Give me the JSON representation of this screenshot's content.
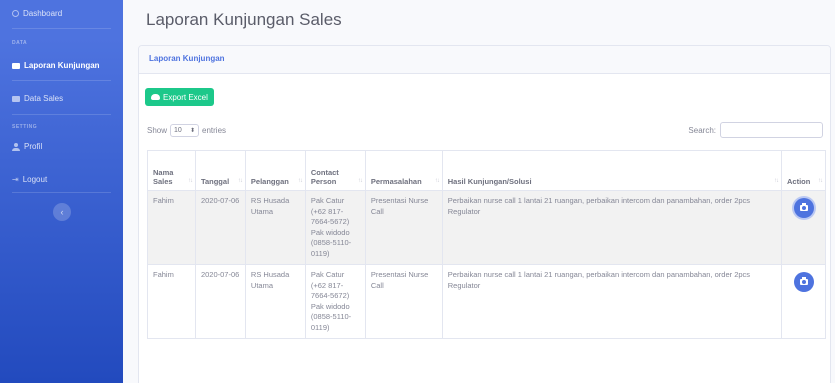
{
  "sidebar": {
    "dashboard": "Dashboard",
    "heading_data": "DATA",
    "laporan": "Laporan Kunjungan",
    "data_sales": "Data Sales",
    "heading_setting": "SETTING",
    "profil": "Profil",
    "logout": "Logout",
    "toggle_icon": "‹"
  },
  "page": {
    "title": "Laporan Kunjungan Sales"
  },
  "card": {
    "header": "Laporan Kunjungan",
    "export_label": "Export Excel",
    "show_label": "Show",
    "entries_value": "10",
    "entries_label": "entries",
    "search_label": "Search:",
    "search_value": ""
  },
  "table": {
    "headers": {
      "nama_sales": "Nama Sales",
      "tanggal": "Tanggal",
      "pelanggan": "Pelanggan",
      "contact_person": "Contact Person",
      "permasalahan": "Permasalahan",
      "hasil": "Hasil Kunjungan/Solusi",
      "action": "Action"
    },
    "rows": [
      {
        "nama_sales": "Fahim",
        "tanggal": "2020-07-06",
        "pelanggan": "RS Husada Utama",
        "contact_person": "Pak Catur (+62 817-7664-5672) Pak widodo (0858-5110-0119)",
        "permasalahan": "Presentasi Nurse Call",
        "hasil": "Perbaikan nurse call 1 lantai 21 ruangan, perbaikan intercom dan panambahan, order 2pcs Regulator"
      },
      {
        "nama_sales": "Fahim",
        "tanggal": "2020-07-06",
        "pelanggan": "RS Husada Utama",
        "contact_person": "Pak Catur (+62 817-7664-5672) Pak widodo (0858-5110-0119)",
        "permasalahan": "Presentasi Nurse Call",
        "hasil": "Perbaikan nurse call 1 lantai 21 ruangan, perbaikan intercom dan panambahan, order 2pcs Regulator"
      }
    ]
  },
  "colors": {
    "primary": "#4e73df",
    "success": "#1cc88a",
    "sidebar_bottom": "#224abe"
  },
  "icons": [
    "gauge-icon",
    "folder-icon",
    "user-icon",
    "logout-icon",
    "cloud-upload-icon",
    "camera-icon",
    "chevron-left-icon"
  ]
}
